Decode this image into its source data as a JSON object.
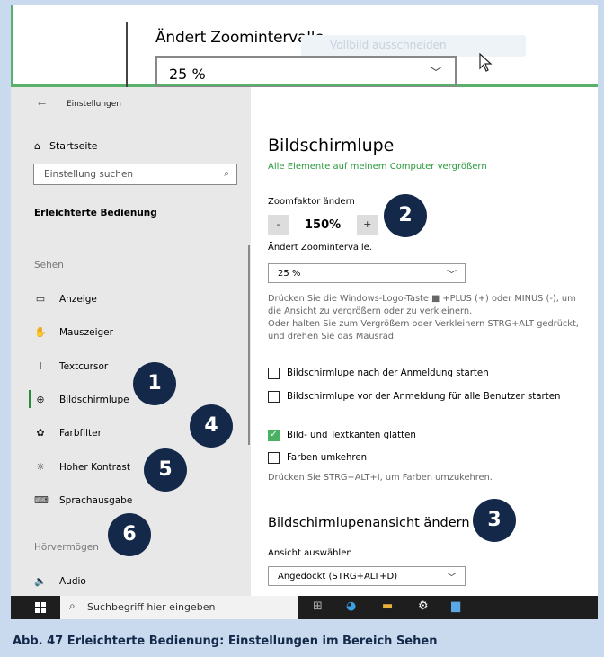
{
  "magnifier_preview": {
    "label": "Ändert Zoomintervalle.",
    "ghost_button": "Vollbild ausschneiden",
    "select_value": "25 %"
  },
  "sidebar": {
    "window_title": "Einstellungen",
    "home": "Startseite",
    "search_placeholder": "Einstellung suchen",
    "category": "Erleichterte Bedienung",
    "section_sehen": "Sehen",
    "items": [
      {
        "label": "Anzeige",
        "icon": "display-icon"
      },
      {
        "label": "Mauszeiger",
        "icon": "mouse-pointer-icon"
      },
      {
        "label": "Textcursor",
        "icon": "text-cursor-icon"
      },
      {
        "label": "Bildschirmlupe",
        "icon": "magnifier-icon"
      },
      {
        "label": "Farbfilter",
        "icon": "palette-icon"
      },
      {
        "label": "Hoher Kontrast",
        "icon": "sun-icon"
      },
      {
        "label": "Sprachausgabe",
        "icon": "narrator-icon"
      }
    ],
    "section_hoeren": "Hörvermögen",
    "audio": "Audio"
  },
  "content": {
    "title": "Bildschirmlupe",
    "subtitle_link": "Alle Elemente auf meinem Computer vergrößern",
    "zoom_label": "Zoomfaktor ändern",
    "zoom_minus": "-",
    "zoom_value": "150%",
    "zoom_plus": "+",
    "interval_label": "Ändert Zoomintervalle.",
    "interval_value": "25 %",
    "desc_1": "Drücken Sie die Windows-Logo-Taste ■ +PLUS (+) oder MINUS (-), um die Ansicht zu vergrößern oder zu verkleinern.",
    "desc_2": "Oder halten Sie zum Vergrößern oder Verkleinern STRG+ALT gedrückt, und drehen Sie das Mausrad.",
    "cb_start_after_login": "Bildschirmlupe nach der Anmeldung starten",
    "cb_start_before_login": "Bildschirmlupe vor der Anmeldung für alle Benutzer starten",
    "cb_smooth": "Bild- und Textkanten glätten",
    "cb_invert": "Farben umkehren",
    "invert_hint": "Drücken Sie STRG+ALT+I, um Farben umzukehren.",
    "view_title": "Bildschirmlupenansicht ändern",
    "view_label": "Ansicht auswählen",
    "view_value": "Angedockt (STRG+ALT+D)"
  },
  "checkbox_states": {
    "after_login": false,
    "before_login": false,
    "smooth": true,
    "invert": false
  },
  "badges": [
    "1",
    "2",
    "3",
    "4",
    "5",
    "6"
  ],
  "taskbar": {
    "search_placeholder": "Suchbegriff hier eingeben"
  },
  "caption": "Abb. 47  Erleichterte Bedienung: Einstellungen im Bereich Sehen",
  "colors": {
    "accent_green": "#2a9a3c",
    "badge": "#14294a",
    "background": "#c9d9ee"
  }
}
